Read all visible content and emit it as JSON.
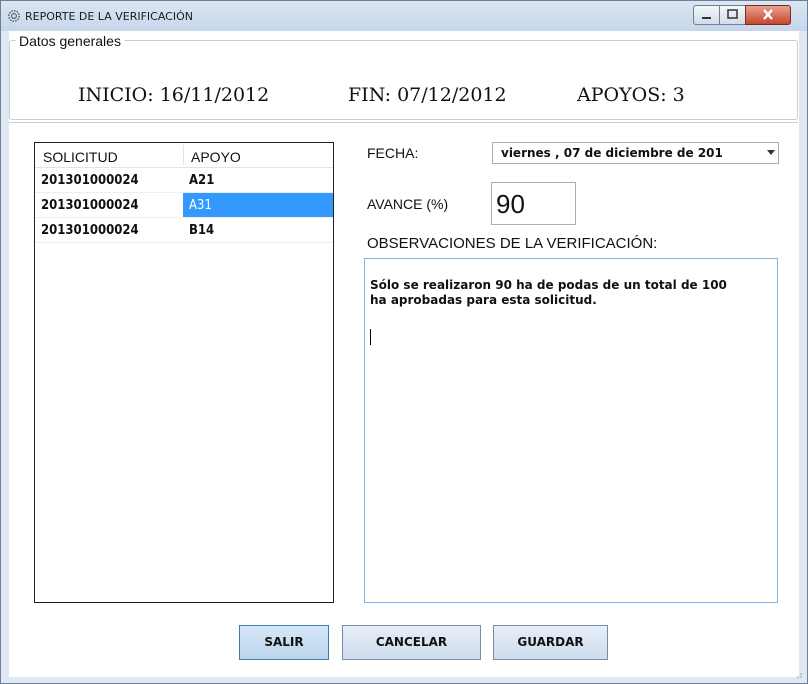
{
  "window": {
    "title": "REPORTE DE LA VERIFICACIÓN",
    "icon": "gear-icon"
  },
  "groupbox": {
    "legend": "Datos generales"
  },
  "header": {
    "inicio_label": "INICIO: 16/11/2012",
    "fin_label": "FIN: 07/12/2012",
    "apoyos_label": "APOYOS: 3"
  },
  "list": {
    "columns": [
      "SOLICITUD",
      "APOYO"
    ],
    "rows": [
      {
        "solicitud": "201301000024",
        "apoyo": "A21",
        "selected": false
      },
      {
        "solicitud": "201301000024",
        "apoyo": "A31",
        "selected": true
      },
      {
        "solicitud": "201301000024",
        "apoyo": "B14",
        "selected": false
      }
    ],
    "selection_color": "#3399ff"
  },
  "form": {
    "fecha_label": "FECHA:",
    "fecha_value": "viernes  , 07 de  diciembre  de 201",
    "avance_label": "AVANCE (%)",
    "avance_value": "90",
    "observaciones_label": "OBSERVACIONES DE LA VERIFICACIÓN:",
    "observaciones_value": "Sólo se realizaron 90 ha de podas de un total de 100\nha aprobadas para esta solicitud."
  },
  "buttons": {
    "salir": "SALIR",
    "cancelar": "CANCELAR",
    "guardar": "GUARDAR"
  },
  "colors": {
    "title_bar": "#cfddef",
    "close_button": "#c4462d",
    "textarea_border": "#7eb4ea"
  }
}
